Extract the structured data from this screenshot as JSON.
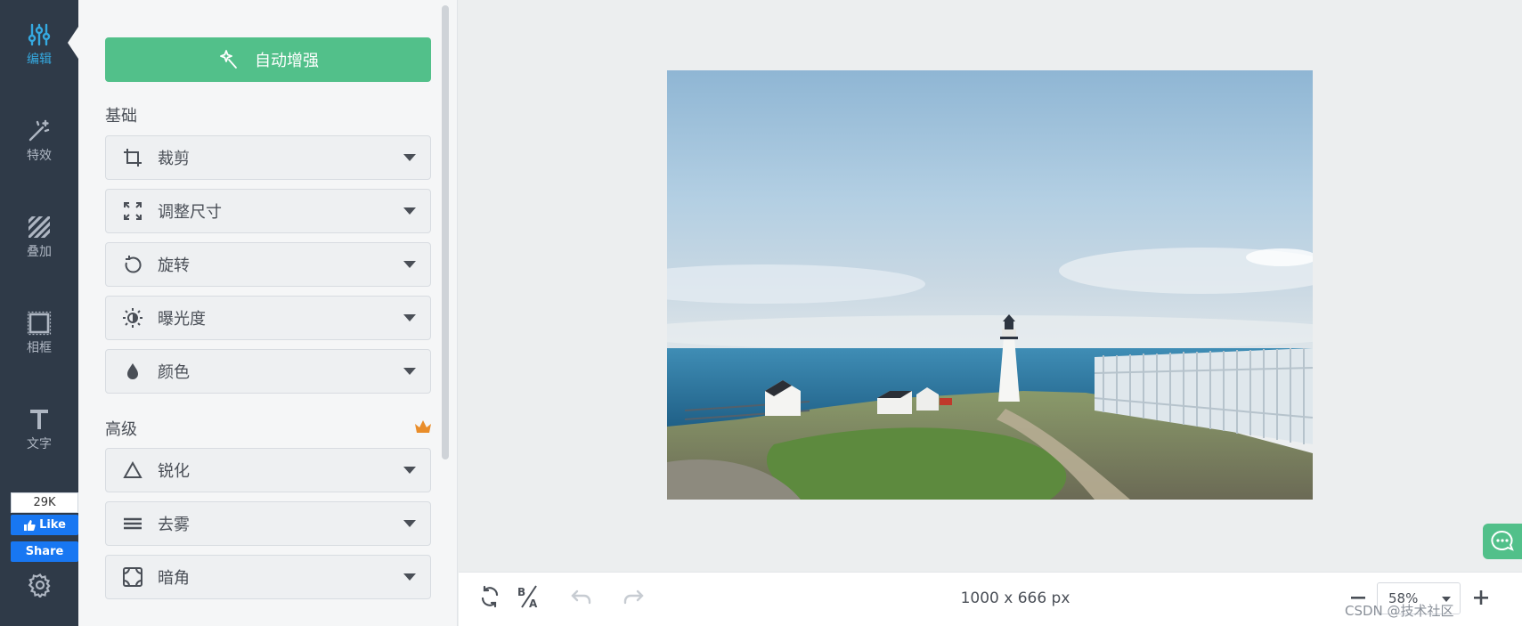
{
  "rail": {
    "items": [
      {
        "label": "编辑",
        "icon": "sliders-icon",
        "active": true
      },
      {
        "label": "特效",
        "icon": "magic-wand-icon"
      },
      {
        "label": "叠加",
        "icon": "stripes-icon"
      },
      {
        "label": "相框",
        "icon": "frame-icon"
      },
      {
        "label": "文字",
        "icon": "text-icon"
      }
    ],
    "facebook": {
      "count": "29K",
      "like_label": "Like",
      "share_label": "Share"
    },
    "settings_icon": "gear-icon"
  },
  "panel": {
    "auto_enhance_label": "自动增强",
    "sections": {
      "basic": {
        "title": "基础",
        "tools": [
          {
            "label": "裁剪",
            "icon": "crop-icon"
          },
          {
            "label": "调整尺寸",
            "icon": "resize-icon"
          },
          {
            "label": "旋转",
            "icon": "rotate-icon"
          },
          {
            "label": "曝光度",
            "icon": "exposure-icon"
          },
          {
            "label": "颜色",
            "icon": "drop-icon"
          }
        ]
      },
      "advanced": {
        "title": "高级",
        "premium_icon": "crown-icon",
        "tools": [
          {
            "label": "锐化",
            "icon": "triangle-icon"
          },
          {
            "label": "去雾",
            "icon": "lines-icon"
          },
          {
            "label": "暗角",
            "icon": "vignette-icon"
          }
        ]
      }
    }
  },
  "canvas": {
    "image_alt": "lighthouse-photo",
    "dimensions": "1000 x 666 px",
    "zoom": "58%"
  },
  "bottom_bar": {
    "icons": [
      "refresh-icon",
      "before-after-icon",
      "undo-icon",
      "redo-icon"
    ],
    "zoom_minus": "minus-icon",
    "zoom_plus": "plus-icon"
  },
  "watermark": "CSDN @技术社区",
  "colors": {
    "rail_bg": "#2f3a48",
    "accent_blue": "#35a9e0",
    "green": "#52c08a",
    "panel_bg": "#f5f6f7",
    "canvas_bg": "#eceeef",
    "facebook": "#1877f2"
  }
}
